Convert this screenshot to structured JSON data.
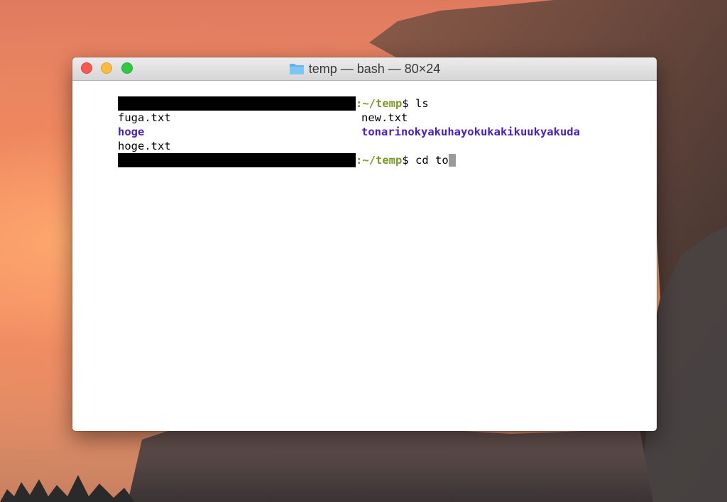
{
  "window": {
    "title": "temp — bash — 80×24",
    "folder_icon": "folder-icon"
  },
  "terminal": {
    "prompt1": {
      "path": ":~/temp",
      "symbol": "$",
      "command": " ls"
    },
    "listing": {
      "col1": [
        {
          "name": "fuga.txt",
          "type": "file"
        },
        {
          "name": "hoge",
          "type": "directory"
        },
        {
          "name": "hoge.txt",
          "type": "file"
        }
      ],
      "col2": [
        {
          "name": "new.txt",
          "type": "file"
        },
        {
          "name": "tonarinokyakuhayokukakikuukyakuda",
          "type": "directory"
        }
      ]
    },
    "prompt2": {
      "path": ":~/temp",
      "symbol": "$",
      "command": " cd to"
    }
  },
  "colors": {
    "path": "#7a9a2a",
    "directory": "#4a1ccf",
    "cursor": "#9a9a9a",
    "close": "#fc5753",
    "minimize": "#fdbc40",
    "zoom": "#33c748"
  }
}
